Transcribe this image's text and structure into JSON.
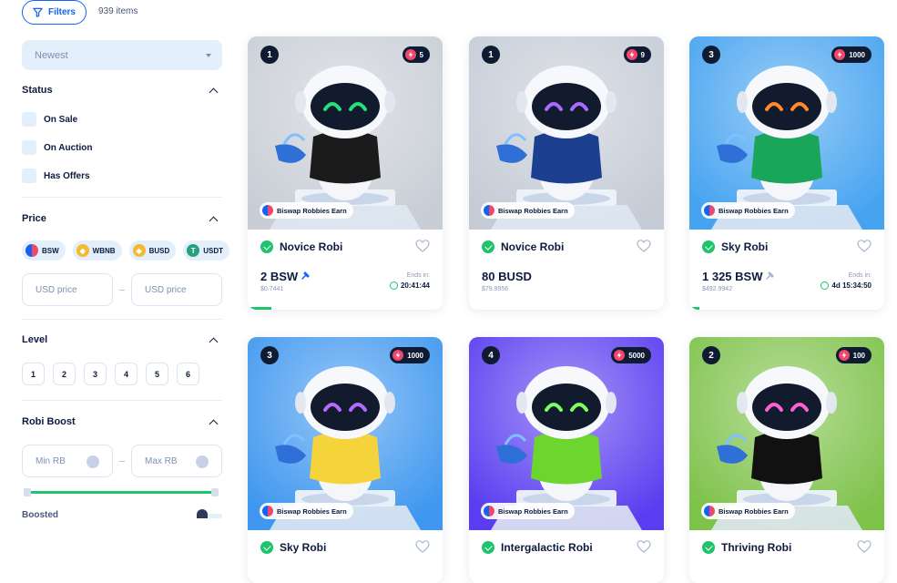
{
  "topbar": {
    "filters_label": "Filters",
    "items_count": "939 items"
  },
  "sidebar": {
    "sort": {
      "value": "Newest"
    },
    "status": {
      "title": "Status",
      "options": [
        "On Sale",
        "On Auction",
        "Has Offers"
      ]
    },
    "price": {
      "title": "Price",
      "coins": [
        {
          "label": "BSW",
          "color": "#1263f1"
        },
        {
          "label": "WBNB",
          "color": "#f3ba2f"
        },
        {
          "label": "BUSD",
          "color": "#f3ba2f"
        },
        {
          "label": "USDT",
          "color": "#26a17b"
        }
      ],
      "min_placeholder": "USD price",
      "max_placeholder": "USD price"
    },
    "level": {
      "title": "Level",
      "options": [
        "1",
        "2",
        "3",
        "4",
        "5",
        "6"
      ]
    },
    "robi_boost": {
      "title": "Robi Boost",
      "min_placeholder": "Min RB",
      "max_placeholder": "Max RB",
      "boosted_label": "Boosted"
    }
  },
  "cards": [
    {
      "level": "1",
      "boost": "5",
      "farm_tag": "Biswap Robbies Earn",
      "name": "Novice Robi",
      "price": "2 BSW",
      "price_usd": "$0.7441",
      "ends_label": "Ends in:",
      "timer": "20:41:44",
      "bg": "#c9ced6",
      "visor": "#22e07a",
      "outfit": "#1b1b1b",
      "progress": 0.12
    },
    {
      "level": "1",
      "boost": "9",
      "farm_tag": "Biswap Robbies Earn",
      "name": "Novice Robi",
      "price": "80 BUSD",
      "price_usd": "$79.9956",
      "ends_label": "",
      "timer": "",
      "bg": "#c5ccd6",
      "visor": "#a96bff",
      "outfit": "#1d3f8f",
      "progress": 0
    },
    {
      "level": "3",
      "boost": "1000",
      "farm_tag": "Biswap Robbies Earn",
      "name": "Sky Robi",
      "price": "1 325 BSW",
      "price_usd": "$492.9942",
      "ends_label": "Ends in:",
      "timer": "4d 15:34:50",
      "bg": "#46a3f0",
      "visor": "#ff8a2a",
      "outfit": "#1aa65a",
      "progress": 0.05
    },
    {
      "level": "3",
      "boost": "1000",
      "farm_tag": "Biswap Robbies Earn",
      "name": "Sky Robi",
      "price": "",
      "price_usd": "",
      "ends_label": "",
      "timer": "",
      "bg": "#3f97ef",
      "visor": "#b56bff",
      "outfit": "#f5d33a",
      "progress": 0
    },
    {
      "level": "4",
      "boost": "5000",
      "farm_tag": "Biswap Robbies Earn",
      "name": "Intergalactic Robi",
      "price": "",
      "price_usd": "",
      "ends_label": "",
      "timer": "",
      "bg": "#5a3df0",
      "visor": "#7bff5a",
      "outfit": "#6cd62e",
      "progress": 0
    },
    {
      "level": "2",
      "boost": "100",
      "farm_tag": "Biswap Robbies Earn",
      "name": "Thriving Robi",
      "price": "",
      "price_usd": "",
      "ends_label": "",
      "timer": "",
      "bg": "#7ec24a",
      "visor": "#ff5fd2",
      "outfit": "#111111",
      "progress": 0
    }
  ]
}
